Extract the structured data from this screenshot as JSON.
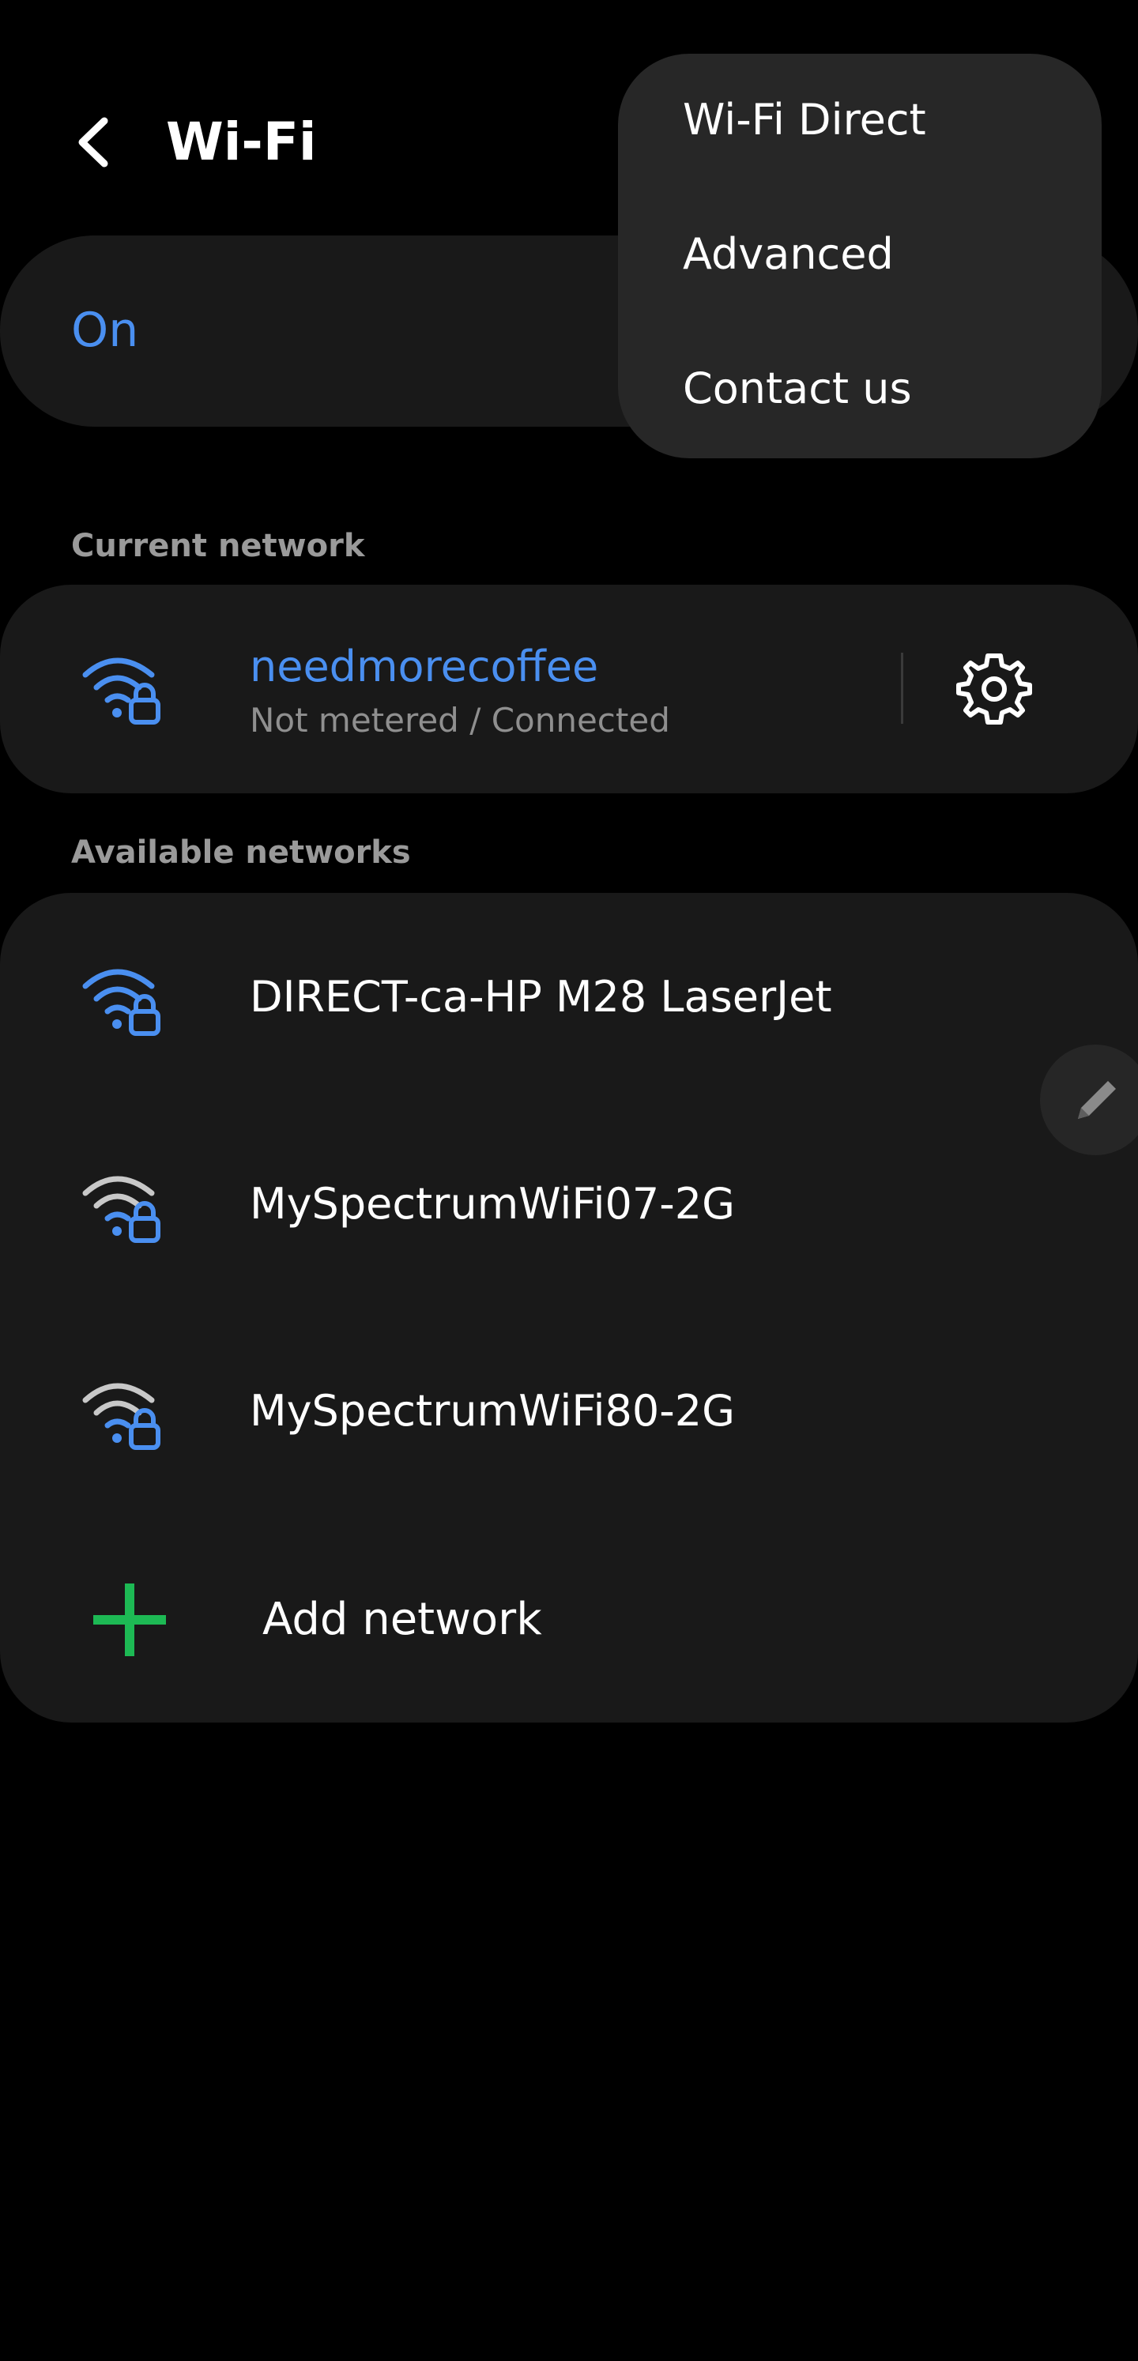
{
  "header": {
    "title": "Wi-Fi",
    "back_icon": "chevron-left-icon"
  },
  "toggle": {
    "label": "On"
  },
  "current_section": {
    "title": "Current network"
  },
  "current_network": {
    "name": "needmorecoffee",
    "status": "Not metered / Connected",
    "icon": "wifi-lock-icon",
    "settings_icon": "gear-icon"
  },
  "available_section": {
    "title": "Available networks"
  },
  "available_networks": [
    {
      "name": "DIRECT-ca-HP M28 LaserJet",
      "signal_color": "#4a8ff0"
    },
    {
      "name": "MySpectrumWiFi07-2G",
      "signal_color": "#c8c8c8"
    },
    {
      "name": "MySpectrumWiFi80-2G",
      "signal_color": "#c8c8c8"
    }
  ],
  "add_network": {
    "label": "Add network",
    "icon": "plus-icon"
  },
  "menu": {
    "items": [
      {
        "label": "Wi-Fi Direct"
      },
      {
        "label": "Advanced"
      },
      {
        "label": "Contact us"
      }
    ]
  },
  "edit_fab": {
    "icon": "pencil-icon"
  },
  "colors": {
    "accent": "#4a8ff0",
    "lock": "#4a8ff0",
    "add": "#1db954",
    "card": "#191919",
    "menu": "#272727"
  }
}
